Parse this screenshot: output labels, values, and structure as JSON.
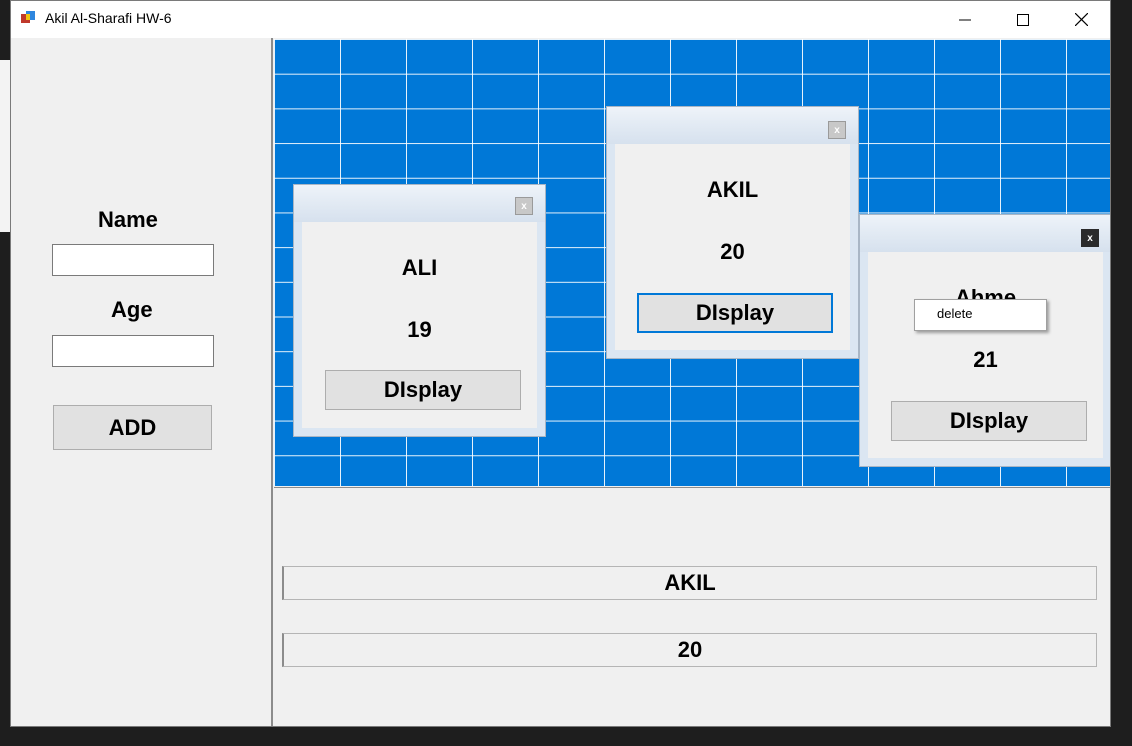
{
  "window": {
    "title": "Akil Al-Sharafi HW-6",
    "icons": {
      "app": "app-icon",
      "minimize": "minimize-icon",
      "maximize": "maximize-icon",
      "close": "close-icon"
    }
  },
  "form": {
    "name_label": "Name",
    "name_value": "",
    "age_label": "Age",
    "age_value": "",
    "add_label": "ADD"
  },
  "cards": [
    {
      "name": "ALI",
      "age": "19",
      "button": "DIsplay",
      "close": "x"
    },
    {
      "name": "AKIL",
      "age": "20",
      "button": "DIsplay",
      "close": "x"
    },
    {
      "name": "Ahme",
      "age": "21",
      "button": "DIsplay",
      "close": "x"
    }
  ],
  "context_menu": {
    "items": [
      "delete"
    ]
  },
  "display": {
    "name": "AKIL",
    "age": "20"
  },
  "colors": {
    "grid_background": "#0078d7",
    "grid_lines": "#ffffff",
    "form_background": "#f0f0f0"
  }
}
